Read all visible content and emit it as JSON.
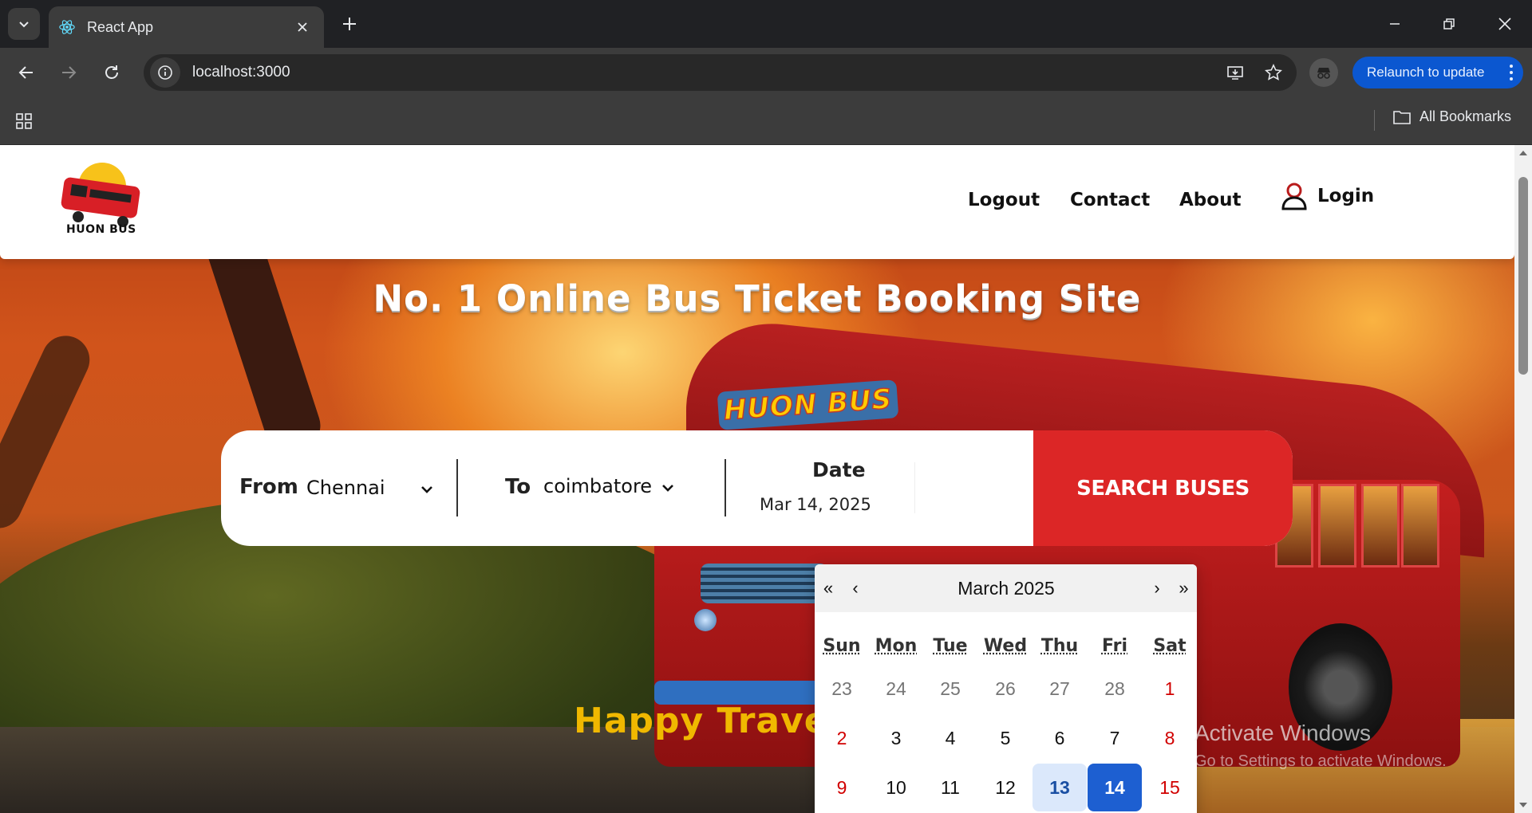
{
  "browser": {
    "tab_title": "React App",
    "url": "localhost:3000",
    "relaunch_label": "Relaunch to update",
    "all_bookmarks_label": "All Bookmarks"
  },
  "site": {
    "logo_text": "HUON BUS",
    "nav": {
      "logout": "Logout",
      "contact": "Contact",
      "about": "About",
      "login": "Login"
    },
    "headline": "No. 1 Online Bus Ticket Booking Site",
    "bus_sign": "HUON BUS",
    "tagline": "Happy Travel",
    "search": {
      "from_label": "From",
      "from_value": "Chennai",
      "to_label": "To",
      "to_value": "coimbatore",
      "date_label": "Date",
      "date_value": "Mar 14, 2025",
      "button_label": "SEARCH BUSES"
    },
    "calendar": {
      "month_label": "March 2025",
      "prev_year": "«",
      "prev_month": "‹",
      "next_month": "›",
      "next_year": "»",
      "weekdays": [
        "Sun",
        "Mon",
        "Tue",
        "Wed",
        "Thu",
        "Fri",
        "Sat"
      ],
      "weeks": [
        [
          "23",
          "24",
          "25",
          "26",
          "27",
          "28",
          "1"
        ],
        [
          "2",
          "3",
          "4",
          "5",
          "6",
          "7",
          "8"
        ],
        [
          "9",
          "10",
          "11",
          "12",
          "13",
          "14",
          "15"
        ]
      ],
      "today": "13",
      "selected": "14"
    }
  },
  "os": {
    "watermark_title": "Activate Windows",
    "watermark_sub": "Go to Settings to activate Windows."
  },
  "colors": {
    "brand_red": "#dc2626",
    "accent_blue": "#1d5fd1",
    "tagline_gold": "#f0b800"
  }
}
